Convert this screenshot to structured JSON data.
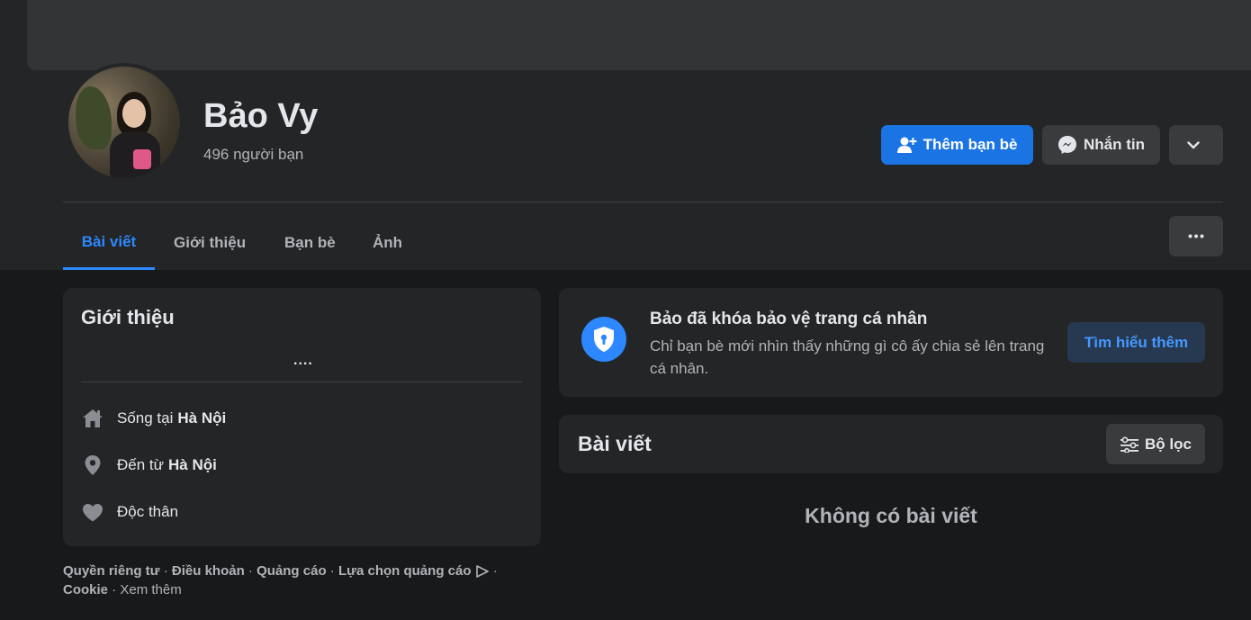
{
  "profile": {
    "name": "Bảo Vy",
    "friends_count": "496 người bạn"
  },
  "actions": {
    "add_friend": "Thêm bạn bè",
    "message": "Nhắn tin"
  },
  "tabs": [
    {
      "label": "Bài viết",
      "active": true
    },
    {
      "label": "Giới thiệu",
      "active": false
    },
    {
      "label": "Bạn bè",
      "active": false
    },
    {
      "label": "Ảnh",
      "active": false
    }
  ],
  "intro": {
    "title": "Giới thiệu",
    "bio": "....",
    "lives_in_prefix": "Sống tại",
    "lives_in": "Hà Nội",
    "from_prefix": "Đến từ",
    "from": "Hà Nội",
    "relationship": "Độc thân"
  },
  "lock_notice": {
    "title": "Bảo đã khóa bảo vệ trang cá nhân",
    "description": "Chỉ bạn bè mới nhìn thấy những gì cô ấy chia sẻ lên trang cá nhân.",
    "button": "Tìm hiểu thêm"
  },
  "posts": {
    "title": "Bài viết",
    "filter": "Bộ lọc",
    "empty": "Không có bài viết"
  },
  "footer": {
    "privacy": "Quyền riêng tư",
    "terms": "Điều khoản",
    "ads": "Quảng cáo",
    "ad_choices": "Lựa chọn quảng cáo",
    "cookies": "Cookie",
    "more": "Xem thêm"
  },
  "colors": {
    "accent": "#1b74e4",
    "link_active": "#2d88ff",
    "background": "#18191a",
    "surface": "#242526"
  }
}
